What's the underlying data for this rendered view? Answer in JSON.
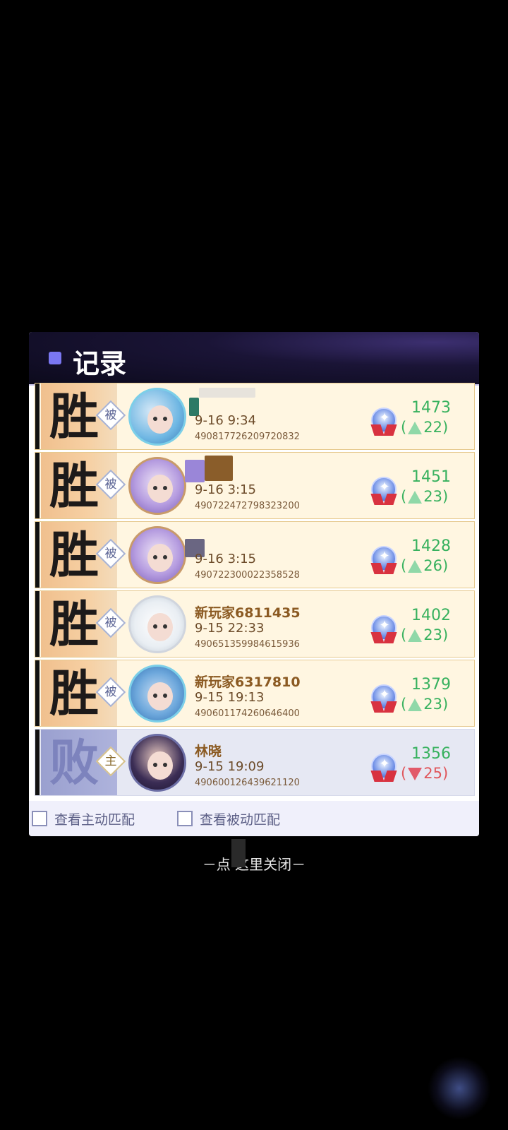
{
  "header": {
    "title": "记录"
  },
  "records": [
    {
      "result": "胜",
      "role": "被",
      "name": "",
      "time": "9-16 9:34",
      "match_id": "490817726209720832",
      "score": "1473",
      "delta_open": "(",
      "delta": "22",
      "delta_close": ")",
      "direction": "up"
    },
    {
      "result": "胜",
      "role": "被",
      "name": "",
      "time": "9-16 3:15",
      "match_id": "490722472798323200",
      "score": "1451",
      "delta_open": "(",
      "delta": "23",
      "delta_close": ")",
      "direction": "up"
    },
    {
      "result": "胜",
      "role": "被",
      "name": "",
      "time": "9-16 3:15",
      "match_id": "490722300022358528",
      "score": "1428",
      "delta_open": "(",
      "delta": "26",
      "delta_close": ")",
      "direction": "up"
    },
    {
      "result": "胜",
      "role": "被",
      "name": "新玩家6811435",
      "time": "9-15 22:33",
      "match_id": "490651359984615936",
      "score": "1402",
      "delta_open": "(",
      "delta": "23",
      "delta_close": ")",
      "direction": "up"
    },
    {
      "result": "胜",
      "role": "被",
      "name": "新玩家6317810",
      "time": "9-15 19:13",
      "match_id": "490601174260646400",
      "score": "1379",
      "delta_open": "(",
      "delta": "23",
      "delta_close": ")",
      "direction": "up"
    },
    {
      "result": "败",
      "role": "主",
      "name": "林晓",
      "time": "9-15 19:09",
      "match_id": "490600126439621120",
      "score": "1356",
      "delta_open": "(",
      "delta": "25",
      "delta_close": ")",
      "direction": "down"
    }
  ],
  "filters": {
    "active_label": "查看主动匹配",
    "passive_label": "查看被动匹配"
  },
  "close_hint": "－点  这里关闭－",
  "colors": {
    "win_score": "#37b15e",
    "loss_delta": "#e0555a",
    "accent": "#7a77f2"
  }
}
